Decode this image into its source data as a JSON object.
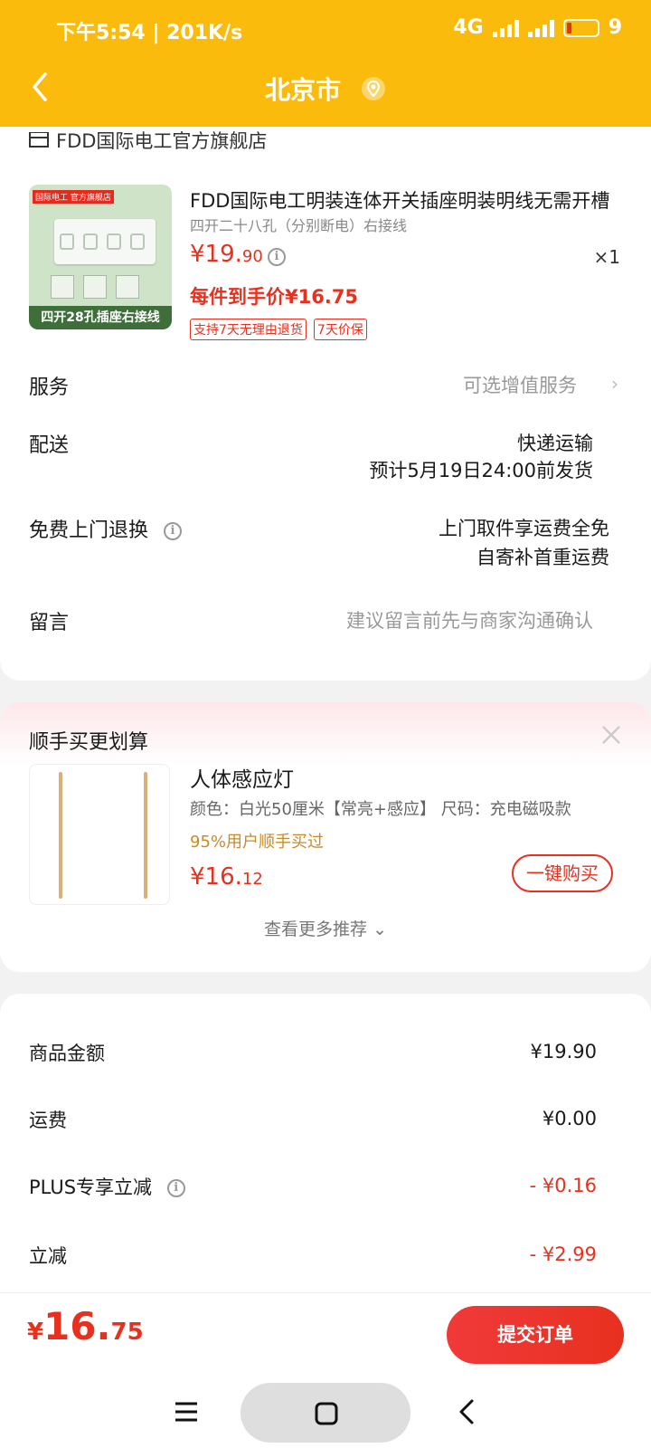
{
  "status_bar": {
    "time_speed": "下午5:54 | 201K/s",
    "network": "4G",
    "battery": "9"
  },
  "nav": {
    "title": "北京市"
  },
  "store": {
    "name": "FDD国际电工官方旗舰店"
  },
  "product": {
    "title": "FDD国际电工明装连体开关插座明装明线无需开槽",
    "spec": "四开二十八孔（分别断电）右接线",
    "price_int": "¥19.",
    "price_dec": "90",
    "qty": "×1",
    "final_price": "每件到手价¥16.75",
    "tags": [
      "支持7天无理由退货",
      "7天价保"
    ],
    "image": {
      "brand_tag": "国际电工 官方旗舰店",
      "caption": "四开28孔插座右接线"
    }
  },
  "rows": {
    "service": {
      "label": "服务",
      "value": "可选增值服务"
    },
    "delivery": {
      "label": "配送",
      "value1": "快递运输",
      "value2": "预计5月19日24:00前发货"
    },
    "free_return": {
      "label": "免费上门退换",
      "value1": "上门取件享运费全免",
      "value2": "自寄补首重运费"
    },
    "message": {
      "label": "留言",
      "placeholder": "建议留言前先与商家沟通确认"
    }
  },
  "recommend": {
    "title": "顺手买更划算",
    "name": "人体感应灯",
    "spec": "颜色：白光50厘米【常亮+感应】 尺码：充电磁吸款",
    "social": "95%用户顺手买过",
    "price_int": "¥16.",
    "price_dec": "12",
    "buy_label": "一键购买",
    "more_label": "查看更多推荐"
  },
  "fees": [
    {
      "label": "商品金额",
      "value": "¥19.90",
      "info": false,
      "red": false
    },
    {
      "label": "运费",
      "value": "¥0.00",
      "info": false,
      "red": false
    },
    {
      "label": "PLUS专享立减",
      "value": "- ¥0.16",
      "info": true,
      "red": true
    },
    {
      "label": "立减",
      "value": "- ¥2.99",
      "info": false,
      "red": true
    }
  ],
  "bottom": {
    "currency": "¥",
    "total_int": "16.",
    "total_dec": "75",
    "submit_label": "提交订单"
  },
  "colors": {
    "header": "#fbbb0c",
    "accent_red": "#e8301f",
    "social_gold": "#c88b2a"
  }
}
